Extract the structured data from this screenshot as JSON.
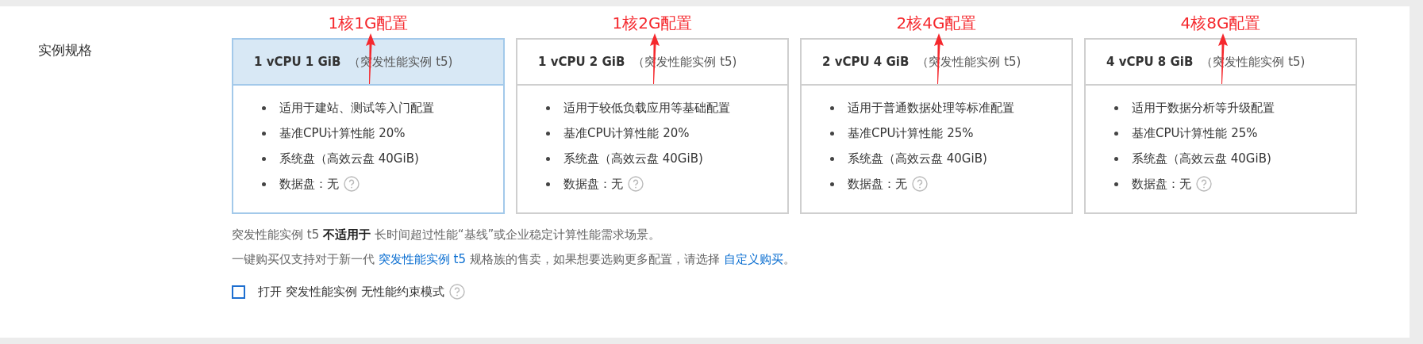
{
  "section_label": "实例规格",
  "cards": [
    {
      "spec": "1 vCPU 1 GiB",
      "family": "（突发性能实例 t5)",
      "selected": true,
      "annotation": "1核1G配置",
      "features": [
        "适用于建站、测试等入门配置",
        "基准CPU计算性能 20%",
        "系统盘（高效云盘 40GiB)",
        "数据盘：无"
      ]
    },
    {
      "spec": "1 vCPU 2 GiB",
      "family": "（突发性能实例 t5)",
      "selected": false,
      "annotation": "1核2G配置",
      "features": [
        "适用于较低负载应用等基础配置",
        "基准CPU计算性能 20%",
        "系统盘（高效云盘 40GiB)",
        "数据盘：无"
      ]
    },
    {
      "spec": "2 vCPU 4 GiB",
      "family": "（突发性能实例 t5)",
      "selected": false,
      "annotation": "2核4G配置",
      "features": [
        "适用于普通数据处理等标准配置",
        "基准CPU计算性能 25%",
        "系统盘（高效云盘 40GiB)",
        "数据盘：无"
      ]
    },
    {
      "spec": "4 vCPU 8 GiB",
      "family": "（突发性能实例 t5)",
      "selected": false,
      "annotation": "4核8G配置",
      "features": [
        "适用于数据分析等升级配置",
        "基准CPU计算性能 25%",
        "系统盘（高效云盘 40GiB)",
        "数据盘：无"
      ]
    }
  ],
  "notes": [
    [
      {
        "kind": "text",
        "text": "突发性能实例 t5 **不适用于** 长时间超过性能“基线”或企业稳定计算性能需求场景。"
      }
    ],
    [
      {
        "kind": "text",
        "text": "一键购买仅支持对于新一代 "
      },
      {
        "kind": "link",
        "text": "突发性能实例 t5"
      },
      {
        "kind": "text",
        "text": " 规格族的售卖，如果想要选购更多配置，请选择 "
      },
      {
        "kind": "link",
        "text": "自定义购买"
      },
      {
        "kind": "text",
        "text": "。"
      }
    ]
  ],
  "unlimited_mode": {
    "label": "打开 突发性能实例 无性能约束模式",
    "checked": false
  }
}
